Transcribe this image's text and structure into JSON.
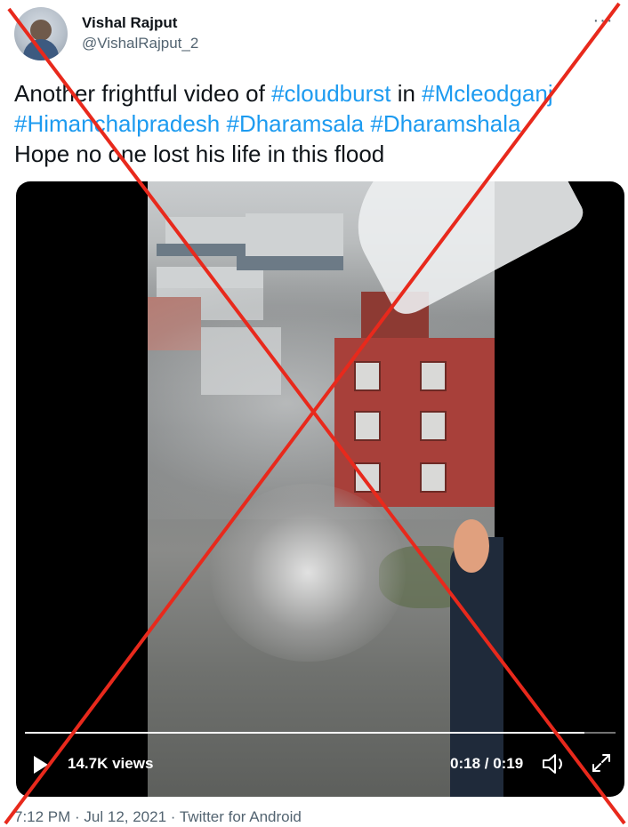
{
  "author": {
    "name": "Vishal Rajput",
    "handle": "@VishalRajput_2"
  },
  "tweet": {
    "line1_text": "Another frightful  video of ",
    "line1_tag1": "#cloudburst",
    "line1_mid": " in ",
    "line1_tag2": "#Mcleodganj",
    "line2_tag1": "#Himanchalpradesh",
    "line2_tag2": "#Dharamsala",
    "line2_tag3": "#Dharamshala",
    "line3_text": "Hope no one lost his life in this flood"
  },
  "video": {
    "views": "14.7K views",
    "time": "0:18 / 0:19",
    "progress": 0.947
  },
  "footer": {
    "meta": "7:12 PM · Jul 12, 2021 · Twitter for Android"
  },
  "icons": [
    "more-icon",
    "play-icon",
    "volume-icon",
    "fullscreen-icon"
  ],
  "colors": {
    "link": "#1d9bf0",
    "cross": "#e8291c",
    "secondary_text": "#536471"
  }
}
